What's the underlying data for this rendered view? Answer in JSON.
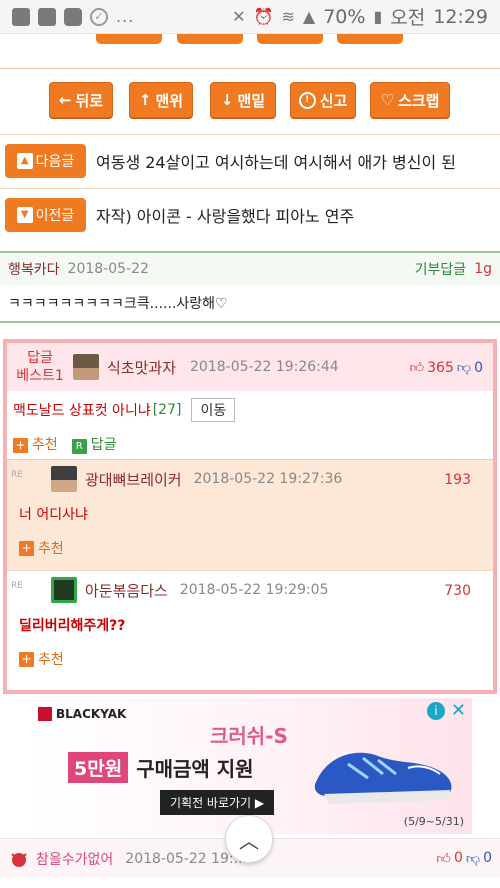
{
  "status_bar": {
    "battery": "70%",
    "ampm": "오전",
    "time": "12:29",
    "more": "..."
  },
  "nav_buttons": {
    "back": "뒤로",
    "top": "맨위",
    "bottom": "맨밑",
    "report": "신고",
    "scrap": "스크랩"
  },
  "post_nav": {
    "next_label": "다음글",
    "next_title": "여동생 24살이고 여시하는데 여시해서 애가 병신이 된",
    "prev_label": "이전글",
    "prev_title": "자작) 아이콘 - 사랑을했다 피아노 연주"
  },
  "comment1": {
    "author": "행복카다",
    "date": "2018-05-22",
    "reply_label": "기부답글",
    "unit": "1g",
    "text": "ㅋㅋㅋㅋㅋㅋㅋㅋㅋ크큭......사랑해♡"
  },
  "best": {
    "label_line1": "답글",
    "label_line2": "베스트1",
    "author": "식초맛과자",
    "datetime": "2018-05-22 19:26:44",
    "up": "365",
    "down": "0",
    "title": "맥도날드 상표컷 아니냐",
    "count": "[27]",
    "move": "이동",
    "recommend": "추천",
    "reply": "답글",
    "replies": [
      {
        "tag": "RE",
        "author": "광대뼈브레이커",
        "datetime": "2018-05-22 19:27:36",
        "votes": "193",
        "text": "너 어디사냐",
        "recommend": "추천"
      },
      {
        "tag": "RE",
        "author": "아둔볶음다스",
        "datetime": "2018-05-22 19:29:05",
        "votes": "730",
        "text": "딜리버리해주게??",
        "recommend": "추천"
      }
    ]
  },
  "ad": {
    "brand": "BLACKYAK",
    "headline": "크러쉬-S",
    "badge": "5만원",
    "main": "구매금액 지원",
    "cta": "기획전 바로가기 ▶",
    "period": "(5/9~5/31)"
  },
  "bottom_comment": {
    "author": "참을수가없어",
    "datetime": "2018-05-22 19:...4",
    "up": "0",
    "down": "0"
  },
  "colors": {
    "accent_orange": "#f07a22",
    "best_border": "#f5b0b4",
    "vote_red": "#d7333a",
    "vote_blue": "#2b59c3"
  },
  "icons": [
    "u-plus-icon",
    "image-icon",
    "youtube-icon",
    "check-icon",
    "mute-icon",
    "alarm-icon",
    "wifi-icon",
    "signal-icon",
    "battery-icon",
    "scroll-top-icon"
  ]
}
